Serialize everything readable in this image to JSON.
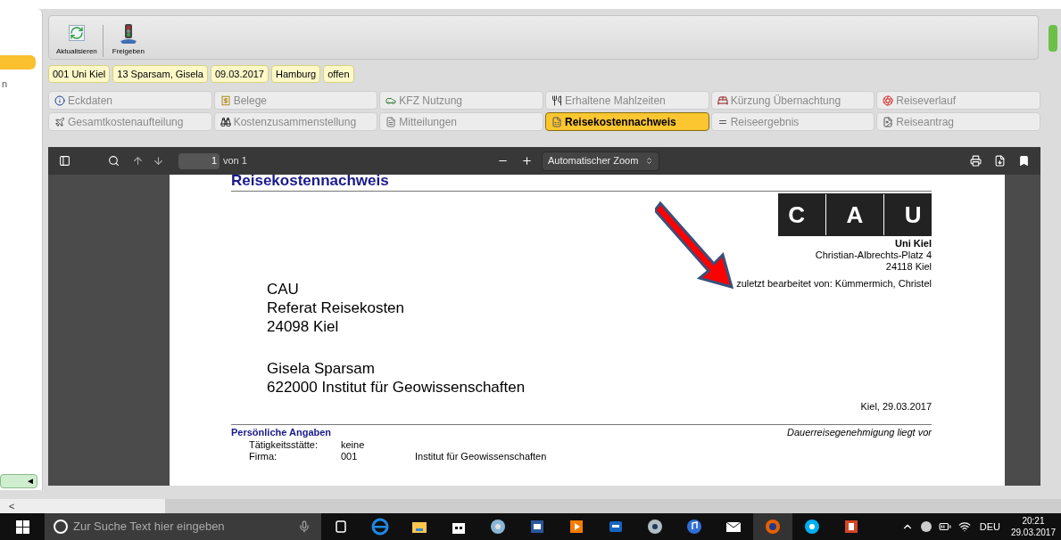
{
  "sidebar": {
    "fragment": "n",
    "collapse_glyph": "◄"
  },
  "toolbar": {
    "buttons": [
      "Aktualisieren",
      "Freigeben"
    ]
  },
  "badges": [
    "001 Uni Kiel",
    "13 Sparsam, Gisela",
    "09.03.2017",
    "Hamburg",
    "offen"
  ],
  "tabs": [
    {
      "label": "Eckdaten",
      "selected": false
    },
    {
      "label": "Belege",
      "selected": false
    },
    {
      "label": "KFZ Nutzung",
      "selected": false
    },
    {
      "label": "Erhaltene Mahlzeiten",
      "selected": false
    },
    {
      "label": "Kürzung Übernachtung",
      "selected": false
    },
    {
      "label": "Reiseverlauf",
      "selected": false
    },
    {
      "label": "Gesamtkostenaufteilung",
      "selected": false
    },
    {
      "label": "Kostenzusammenstellung",
      "selected": false
    },
    {
      "label": "Mitteilungen",
      "selected": false
    },
    {
      "label": "Reisekostennachweis",
      "selected": true
    },
    {
      "label": "Reiseergebnis",
      "selected": false
    },
    {
      "label": "Reiseantrag",
      "selected": false
    }
  ],
  "pdf_viewer": {
    "page": "1",
    "page_count": "von 1",
    "zoom": "Automatischer Zoom",
    "document": {
      "title": "Reisekostennachweis",
      "logo": [
        "C",
        "A",
        "U"
      ],
      "org_name": "Uni Kiel",
      "org_address": [
        "Christian-Albrechts-Platz 4",
        "24118 Kiel"
      ],
      "edited_by": "zuletzt bearbeitet von: Kümmermich, Christel",
      "recipient": [
        "CAU",
        "Referat Reisekosten",
        "24098 Kiel"
      ],
      "sender": [
        "Gisela Sparsam",
        "622000 Institut für Geowissenschaften"
      ],
      "date": "Kiel, 29.03.2017",
      "section": "Persönliche Angaben",
      "note": "Dauerreisegenehmigung liegt vor",
      "rows": [
        [
          "Tätigkeitsstätte:",
          "keine"
        ],
        [
          "Firma:",
          "001",
          "Institut für Geowissenschaften"
        ]
      ]
    }
  },
  "scrollbar": {
    "left_glyph": "<"
  },
  "taskbar": {
    "search_placeholder": "Zur Suche Text hier eingeben",
    "language": "DEU",
    "time": "20:21",
    "date": "29.03.2017"
  }
}
